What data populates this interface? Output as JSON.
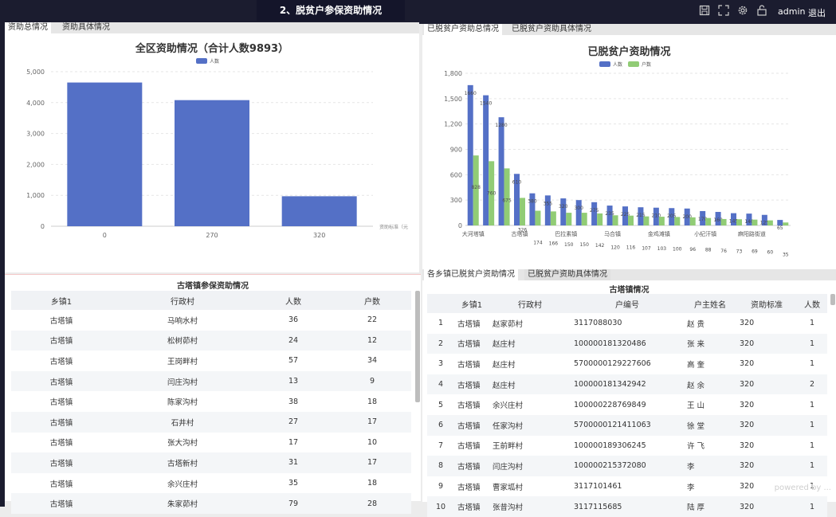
{
  "header": {
    "title": "2、脱贫户参保资助情况",
    "user": "admin",
    "logout": "退出",
    "icons": [
      "save-icon",
      "fullscreen-icon",
      "gear-icon",
      "unlock-icon"
    ]
  },
  "left_panel": {
    "tabs": [
      "资助总情况",
      "资助具体情况"
    ],
    "chart_data": {
      "type": "bar",
      "title": "全区资助情况（合计人数9893）",
      "legend": [
        "人数"
      ],
      "xlabel": "资助标准（元",
      "categories": [
        "0",
        "270",
        "320"
      ],
      "series": [
        {
          "name": "人数",
          "values": [
            4650,
            4080,
            970
          ]
        }
      ],
      "ylim": [
        0,
        5000
      ],
      "yticks": [
        "0",
        "1,000",
        "2,000",
        "3,000",
        "4,000",
        "5,000"
      ],
      "color": "#5470c6"
    }
  },
  "right_panel": {
    "tabs": [
      "已脱贫户资助总情况",
      "已脱贫户资助具体情况"
    ],
    "chart_data": {
      "type": "bar",
      "title": "已脱贫户资助情况",
      "legend": [
        "人数",
        "户数"
      ],
      "xticks": [
        "大河塔镇",
        "古塔镇",
        "巴拉素镇",
        "马合镇",
        "金鸡滩镇",
        "小纪汗镇",
        "麻阳路街道"
      ],
      "series": [
        {
          "name": "人数",
          "values": [
            1660,
            1540,
            1280,
            610,
            380,
            355,
            320,
            300,
            275,
            235,
            225,
            215,
            210,
            205,
            200,
            170,
            160,
            145,
            140,
            125,
            65
          ]
        },
        {
          "name": "户数",
          "values": [
            828,
            760,
            675,
            326,
            174,
            166,
            150,
            150,
            142,
            120,
            116,
            107,
            103,
            100,
            96,
            88,
            76,
            73,
            69,
            60,
            35
          ]
        }
      ],
      "ylim": [
        0,
        1800
      ],
      "yticks": [
        "0",
        "300",
        "600",
        "900",
        "1,200",
        "1,500",
        "1,800"
      ],
      "colors": [
        "#5470c6",
        "#91cc75"
      ]
    }
  },
  "left_table": {
    "title": "古塔镇参保资助情况",
    "headers": [
      "乡镇1",
      "行政村",
      "人数",
      "户数"
    ],
    "rows": [
      [
        "古塔镇",
        "马响水村",
        "36",
        "22"
      ],
      [
        "古塔镇",
        "松树茆村",
        "24",
        "12"
      ],
      [
        "古塔镇",
        "王岗畔村",
        "57",
        "34"
      ],
      [
        "古塔镇",
        "闫庄沟村",
        "13",
        "9"
      ],
      [
        "古塔镇",
        "陈家沟村",
        "38",
        "18"
      ],
      [
        "古塔镇",
        "石井村",
        "27",
        "17"
      ],
      [
        "古塔镇",
        "张大沟村",
        "17",
        "10"
      ],
      [
        "古塔镇",
        "古塔新村",
        "31",
        "17"
      ],
      [
        "古塔镇",
        "余兴庄村",
        "35",
        "18"
      ],
      [
        "古塔镇",
        "朱家茆村",
        "79",
        "28"
      ]
    ]
  },
  "right_table": {
    "tabs": [
      "各乡镇已脱贫户资助情况",
      "已脱贫户资助具体情况"
    ],
    "title": "古塔镇情况",
    "headers": [
      "",
      "乡镇1",
      "行政村",
      "户编号",
      "户主姓名",
      "资助标准",
      "人数"
    ],
    "rows": [
      [
        "1",
        "古塔镇",
        "赵家茆村",
        "3117088030",
        "赵 贵",
        "320",
        "1"
      ],
      [
        "2",
        "古塔镇",
        "赵庄村",
        "100000181320486",
        "张 来",
        "320",
        "1"
      ],
      [
        "3",
        "古塔镇",
        "赵庄村",
        "5700000129227606",
        "高 奎",
        "320",
        "1"
      ],
      [
        "4",
        "古塔镇",
        "赵庄村",
        "100000181342942",
        "赵 余",
        "320",
        "2"
      ],
      [
        "5",
        "古塔镇",
        "余兴庄村",
        "100000228769849",
        "王 山",
        "320",
        "1"
      ],
      [
        "6",
        "古塔镇",
        "任家沟村",
        "5700000121411063",
        "徐 堂",
        "320",
        "1"
      ],
      [
        "7",
        "古塔镇",
        "王前畔村",
        "100000189306245",
        "许 飞",
        "320",
        "1"
      ],
      [
        "8",
        "古塔镇",
        "闫庄沟村",
        "100000215372080",
        "李 ",
        "320",
        "1"
      ],
      [
        "9",
        "古塔镇",
        "曹家坬村",
        "3117101461",
        "李 ",
        "320",
        "1"
      ],
      [
        "10",
        "古塔镇",
        "张昔沟村",
        "3117115685",
        "陆 厚",
        "320",
        "1"
      ]
    ]
  },
  "watermark": "powered by ..."
}
